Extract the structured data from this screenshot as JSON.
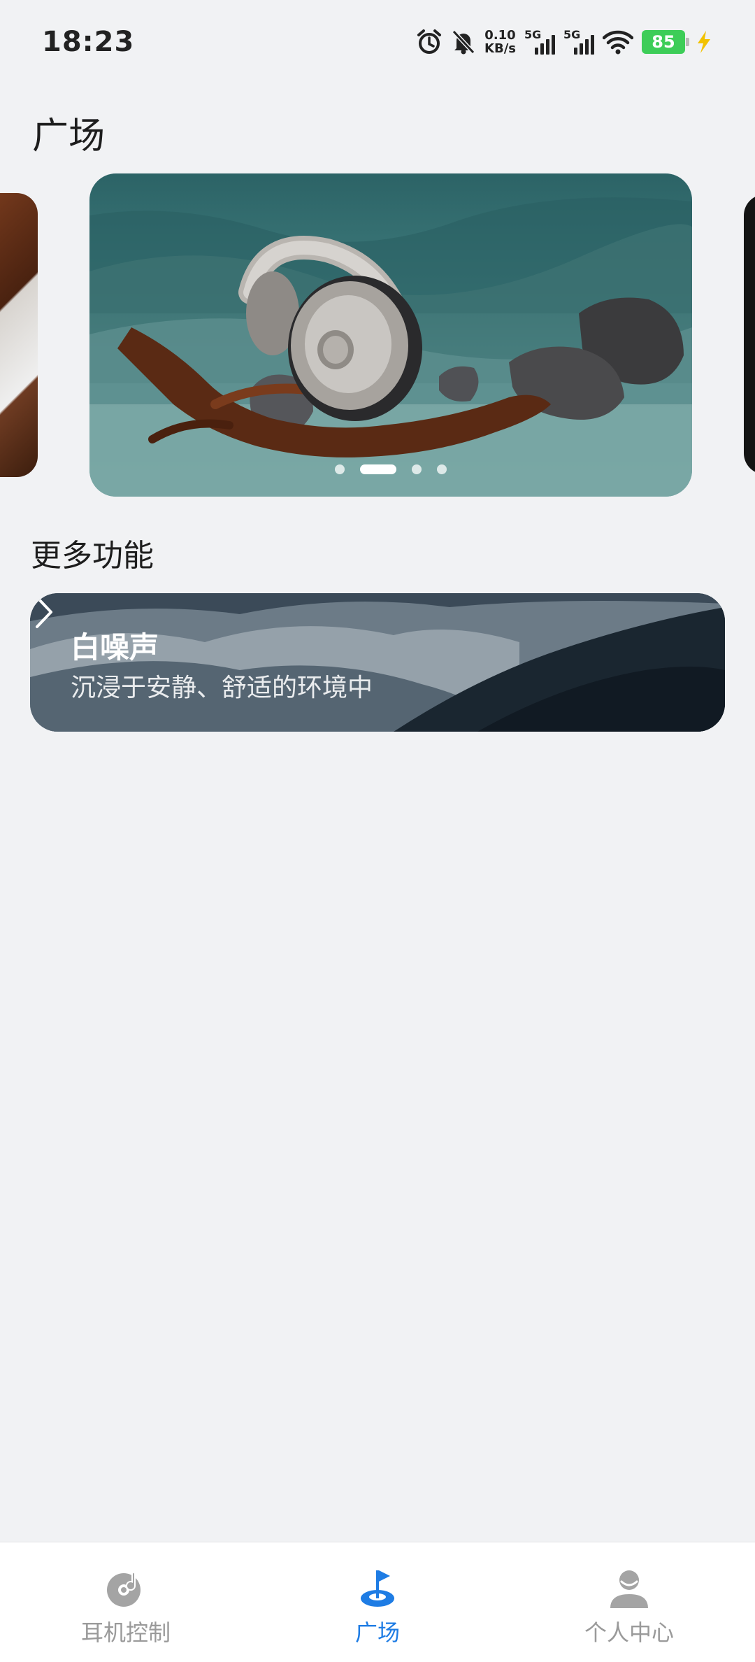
{
  "status_bar": {
    "time": "18:23",
    "net_speed_value": "0.10",
    "net_speed_unit": "KB/s",
    "sim1_tag": "5G",
    "sim2_tag": "5G",
    "battery_level": "85",
    "icons": [
      "alarm-icon",
      "mute-bell-icon",
      "signal-icon",
      "wifi-icon",
      "battery-icon",
      "charging-icon"
    ]
  },
  "page": {
    "title": "广场"
  },
  "carousel": {
    "slide_count": 4,
    "active_index": 1
  },
  "section": {
    "title": "更多功能"
  },
  "feature_card": {
    "title": "白噪声",
    "subtitle": "沉浸于安静、舒适的环境中",
    "icon": "chevron-right-icon"
  },
  "bottom_nav": {
    "active_color": "#1e7ce4",
    "inactive_color": "#9a9a9a",
    "items": [
      {
        "label": "耳机控制",
        "icon": "earphone-control-icon",
        "active": false
      },
      {
        "label": "广场",
        "icon": "plaza-flag-icon",
        "active": true
      },
      {
        "label": "个人中心",
        "icon": "profile-icon",
        "active": false
      }
    ]
  }
}
